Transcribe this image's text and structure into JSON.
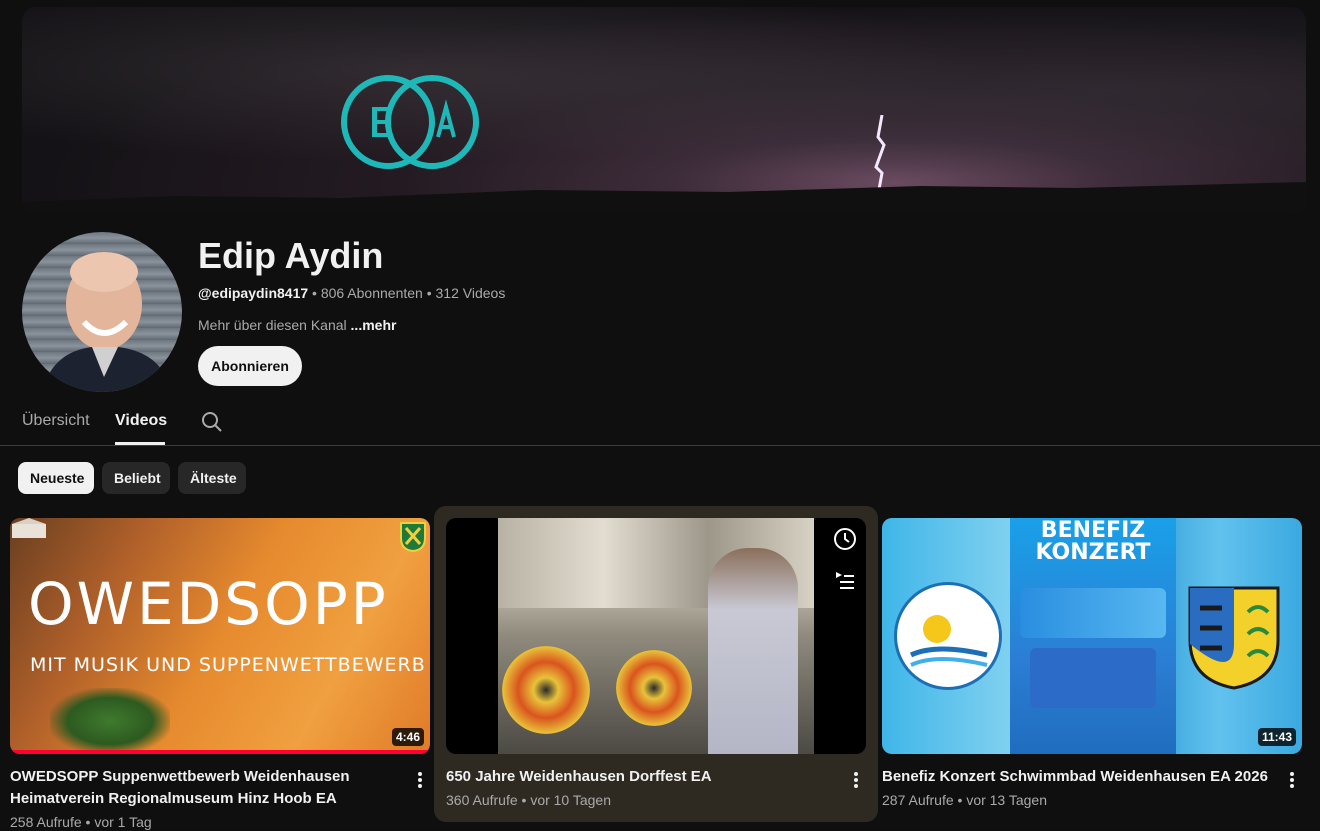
{
  "channel": {
    "name": "Edip Aydin",
    "handle": "@edipaydin8417",
    "subscribers": "806 Abonnenten",
    "videos": "312 Videos",
    "separator": "•",
    "about": "Mehr über diesen Kanal",
    "more": "...mehr",
    "subscribe_label": "Abonnieren"
  },
  "tabs": {
    "overview": "Übersicht",
    "videos": "Videos"
  },
  "chips": {
    "newest": "Neueste",
    "popular": "Beliebt",
    "oldest": "Älteste"
  },
  "videos": [
    {
      "title_line1": "OWEDSOPP Suppenwettbewerb Weidenhausen",
      "title_line2": "Heimatverein Regionalmuseum Hinz Hoob EA",
      "views": "258 Aufrufe",
      "age": "vor 1 Tag",
      "duration": "4:46",
      "thumb_text": "OWEDSOPP",
      "thumb_subtext": "MIT MUSIK UND SUPPENWETTBEWERB"
    },
    {
      "title_line1": "650 Jahre Weidenhausen Dorffest EA",
      "views": "360 Aufrufe",
      "age": "vor 10 Tagen"
    },
    {
      "title_line1": "Benefiz Konzert Schwimmbad Weidenhausen EA 2026",
      "views": "287 Aufrufe",
      "age": "vor 13 Tagen",
      "duration": "11:43",
      "thumb_text_line1": "BENEFIZ",
      "thumb_text_line2": "KONZERT"
    }
  ],
  "colors": {
    "background": "#0f0f0f",
    "progress": "#ff0033",
    "logo_teal": "#1fb8b8"
  }
}
